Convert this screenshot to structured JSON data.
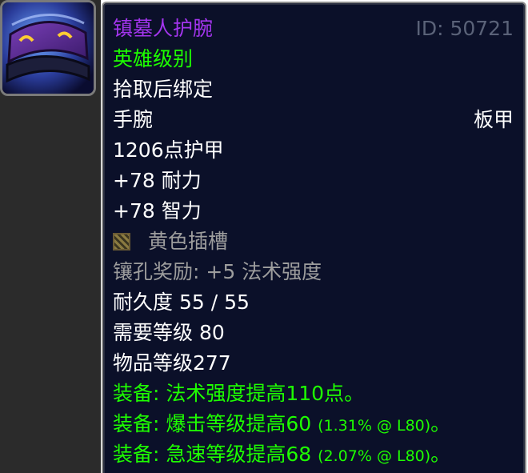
{
  "item": {
    "name": "镇墓人护腕",
    "id_label": "ID: 50721",
    "quality": "英雄级别",
    "binding": "拾取后绑定",
    "slot": "手腕",
    "armor_type": "板甲",
    "armor": "1206点护甲",
    "stat_stamina": "+78 耐力",
    "stat_intellect": "+78 智力",
    "socket": "黄色插槽",
    "socket_bonus": "镶孔奖励: +5 法术强度",
    "durability": "耐久度 55 / 55",
    "required_level": "需要等级 80",
    "item_level": "物品等级277",
    "equip_1": "装备: 法术强度提高110点。",
    "equip_2_main": "装备: 爆击等级提高60",
    "equip_2_detail": "(1.31% @ L80)",
    "equip_2_end": "。",
    "equip_3_main": "装备: 急速等级提高68",
    "equip_3_detail": "(2.07% @ L80)",
    "equip_3_end": "。"
  },
  "colors": {
    "epic": "#a335ee",
    "uncommon": "#1eff00",
    "gray": "#9d9d9d",
    "background": "#0b1029"
  },
  "icons": {
    "item_icon": "plate-bracer-icon",
    "socket_icon": "yellow-socket-icon"
  }
}
